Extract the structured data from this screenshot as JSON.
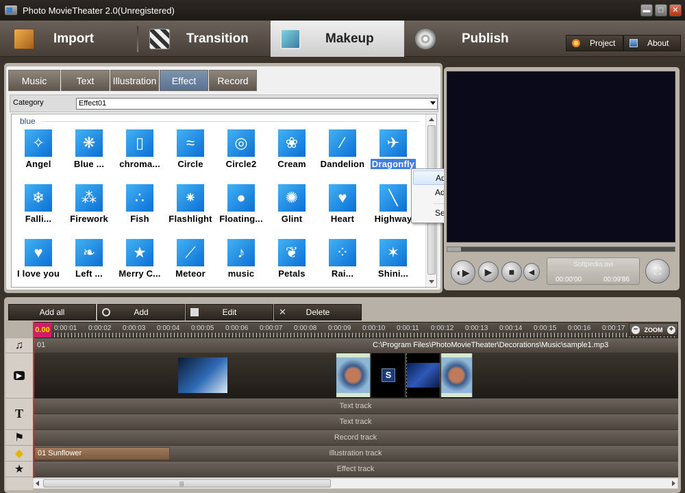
{
  "window": {
    "title": "Photo MovieTheater 2.0(Unregistered)",
    "buttons": {
      "minimize": "▬",
      "maximize": "□",
      "close": "✕"
    }
  },
  "main_tabs": [
    {
      "label": "Import",
      "icon": "import-icon"
    },
    {
      "label": "Transition",
      "icon": "transition-icon"
    },
    {
      "label": "Makeup",
      "icon": "makeup-icon",
      "active": true
    },
    {
      "label": "Publish",
      "icon": "publish-disc-icon"
    }
  ],
  "header_buttons": {
    "project": "Project",
    "about": "About"
  },
  "sub_tabs": [
    {
      "label": "Music"
    },
    {
      "label": "Text"
    },
    {
      "label": "Illustration"
    },
    {
      "label": "Effect",
      "active": true
    },
    {
      "label": "Record"
    }
  ],
  "category": {
    "label": "Category",
    "value": "Effect01"
  },
  "group_label": "blue",
  "effects": [
    {
      "name": "Angel",
      "glyph": "✧"
    },
    {
      "name": "Blue ...",
      "glyph": "❋"
    },
    {
      "name": "chroma...",
      "glyph": "▯"
    },
    {
      "name": "Circle",
      "glyph": "≈"
    },
    {
      "name": "Circle2",
      "glyph": "◎"
    },
    {
      "name": "Cream",
      "glyph": "❀"
    },
    {
      "name": "Dandelion",
      "glyph": "⁄"
    },
    {
      "name": "Dragonfly",
      "glyph": "✈",
      "selected": true
    },
    {
      "name": "Falli...",
      "glyph": "❄"
    },
    {
      "name": "Firework",
      "glyph": "⁂"
    },
    {
      "name": "Fish",
      "glyph": "∴"
    },
    {
      "name": "Flashlight",
      "glyph": "⁕"
    },
    {
      "name": "Floating...",
      "glyph": "●"
    },
    {
      "name": "Glint",
      "glyph": "✺"
    },
    {
      "name": "Heart",
      "glyph": "♥"
    },
    {
      "name": "Highway",
      "glyph": "╲"
    },
    {
      "name": "I love you",
      "glyph": "♥"
    },
    {
      "name": "Left ...",
      "glyph": "❧"
    },
    {
      "name": "Merry C...",
      "glyph": "★"
    },
    {
      "name": "Meteor",
      "glyph": "⟋"
    },
    {
      "name": "music",
      "glyph": "♪"
    },
    {
      "name": "Petals",
      "glyph": "❦"
    },
    {
      "name": "Rai...",
      "glyph": "⁘"
    },
    {
      "name": "Shini...",
      "glyph": "✶"
    }
  ],
  "context_menu": {
    "add": "Add",
    "add_all": "Add all",
    "select_all": "Select all"
  },
  "preview": {
    "filename": "Softpedia.avi",
    "current_time": "00:00'00",
    "total_time": "00:09'86",
    "progress_percent": 6
  },
  "timeline_buttons": {
    "add_all": "Add all",
    "add": "Add",
    "edit": "Edit",
    "delete": "Delete"
  },
  "ruler": {
    "start": "0.00",
    "ticks": [
      "0:00:01",
      "0:00:02",
      "0:00:03",
      "0:00:04",
      "0:00:05",
      "0:00:06",
      "0:00:07",
      "0:00:08",
      "0:00:09",
      "0:00:10",
      "0:00:11",
      "0:00:12",
      "0:00:13",
      "0:00:14",
      "0:00:15",
      "0:00:16",
      "0:00:17"
    ],
    "zoom_label": "ZOOM"
  },
  "tracks": {
    "music_index": "01",
    "music_path": "C:\\Program Files\\PhotoMovieTheater\\Decorations\\Music\\sample1.mp3",
    "text1": "Text track",
    "text2": "Text track",
    "record": "Record track",
    "illustration": "Illustration track",
    "illustration_clip": "01 Sunflower",
    "effect": "Effect track"
  },
  "colors": {
    "accent": "#3d7ee0",
    "playhead": "#e3262e",
    "effect_tile": "#1f8fe8"
  }
}
